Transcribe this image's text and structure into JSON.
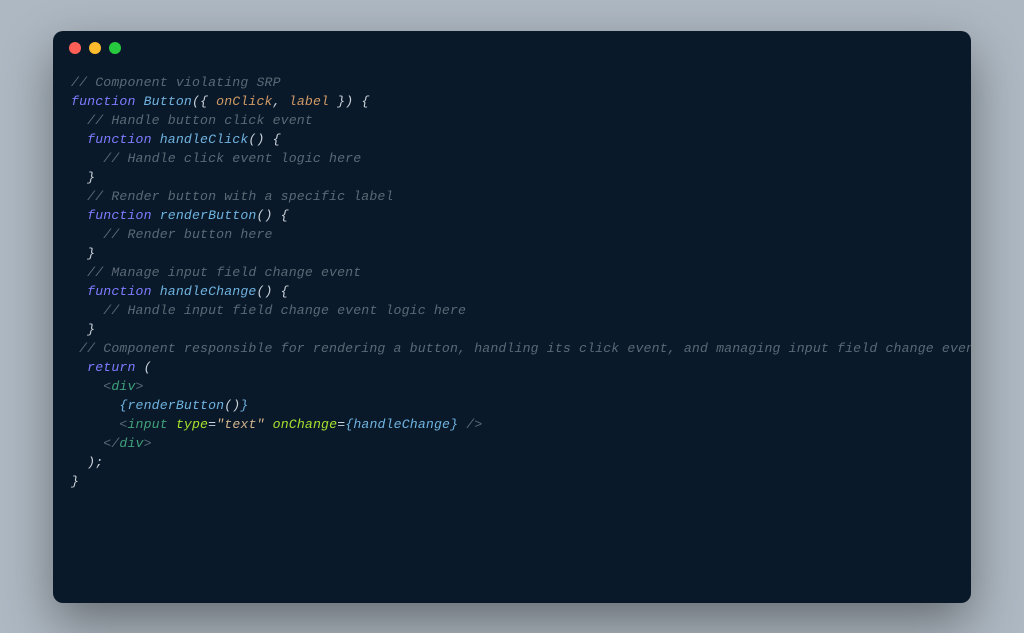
{
  "colors": {
    "background": "#aeb8c2",
    "terminal": "#0a1929",
    "trafficRed": "#ff5f56",
    "trafficYellow": "#ffbd2e",
    "trafficGreen": "#27c93f",
    "comment": "#5b6876",
    "keyword": "#7c7cff",
    "funcname": "#6fb3e0",
    "param": "#d19a66",
    "punct": "#c9d1d9",
    "tag": "#3fa07a",
    "attr": "#a6e22e",
    "string": "#d2b48c"
  },
  "lines": {
    "l1_comment": "// Component violating SRP",
    "l2_kw": "function ",
    "l2_fn": "Button",
    "l2_p1": "({ ",
    "l2_param1": "onClick",
    "l2_comma": ", ",
    "l2_param2": "label",
    "l2_p2": " }) {",
    "l3_comment": "  // Handle button click event",
    "l4_indent": "  ",
    "l4_kw": "function ",
    "l4_fn": "handleClick",
    "l4_p": "() {",
    "l5_comment": "    // Handle click event logic here",
    "l6_brace": "  }",
    "l7_comment": "  // Render button with a specific label",
    "l8_indent": "  ",
    "l8_kw": "function ",
    "l8_fn": "renderButton",
    "l8_p": "() {",
    "l9_comment": "    // Render button here",
    "l10_brace": "  }",
    "l11_comment": "  // Manage input field change event",
    "l12_indent": "  ",
    "l12_kw": "function ",
    "l12_fn": "handleChange",
    "l12_p": "() {",
    "l13_comment": "    // Handle input field change event logic here",
    "l14_brace": "  }",
    "l15_comment": " // Component responsible for rendering a button, handling its click event, and managing input field change event",
    "l16_indent": "  ",
    "l16_kw": "return ",
    "l16_p": "(",
    "l17_indent": "    ",
    "l17_a1": "<",
    "l17_tag": "div",
    "l17_a2": ">",
    "l18_indent": "      ",
    "l18_b1": "{",
    "l18_fn": "renderButton",
    "l18_call": "()",
    "l18_b2": "}",
    "l19_indent": "      ",
    "l19_a1": "<",
    "l19_tag": "input ",
    "l19_attr1": "type",
    "l19_eq1": "=",
    "l19_str": "\"text\"",
    "l19_sp": " ",
    "l19_attr2": "onChange",
    "l19_eq2": "=",
    "l19_b1": "{",
    "l19_hc": "handleChange",
    "l19_b2": "}",
    "l19_close": " />",
    "l20_indent": "    ",
    "l20_a1": "</",
    "l20_tag": "div",
    "l20_a2": ">",
    "l21_close": "  );",
    "l22_brace": "}"
  }
}
